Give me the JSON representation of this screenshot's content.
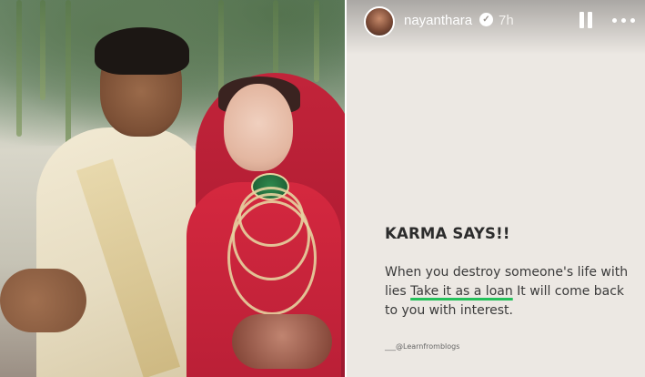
{
  "story": {
    "username": "nayanthara",
    "time": "7h",
    "verified": true,
    "title": "KARMA SAYS!!",
    "body_part1": "When you destroy someone's life with lies ",
    "body_highlight": "Take it as a loan",
    "body_part2": " It will come back to you with interest.",
    "credit": "___@Learnfromblogs",
    "accent_color": "#24c05a"
  },
  "icons": {
    "pause": "pause-icon",
    "more": "more-options-icon",
    "verified": "verified-badge-icon"
  }
}
